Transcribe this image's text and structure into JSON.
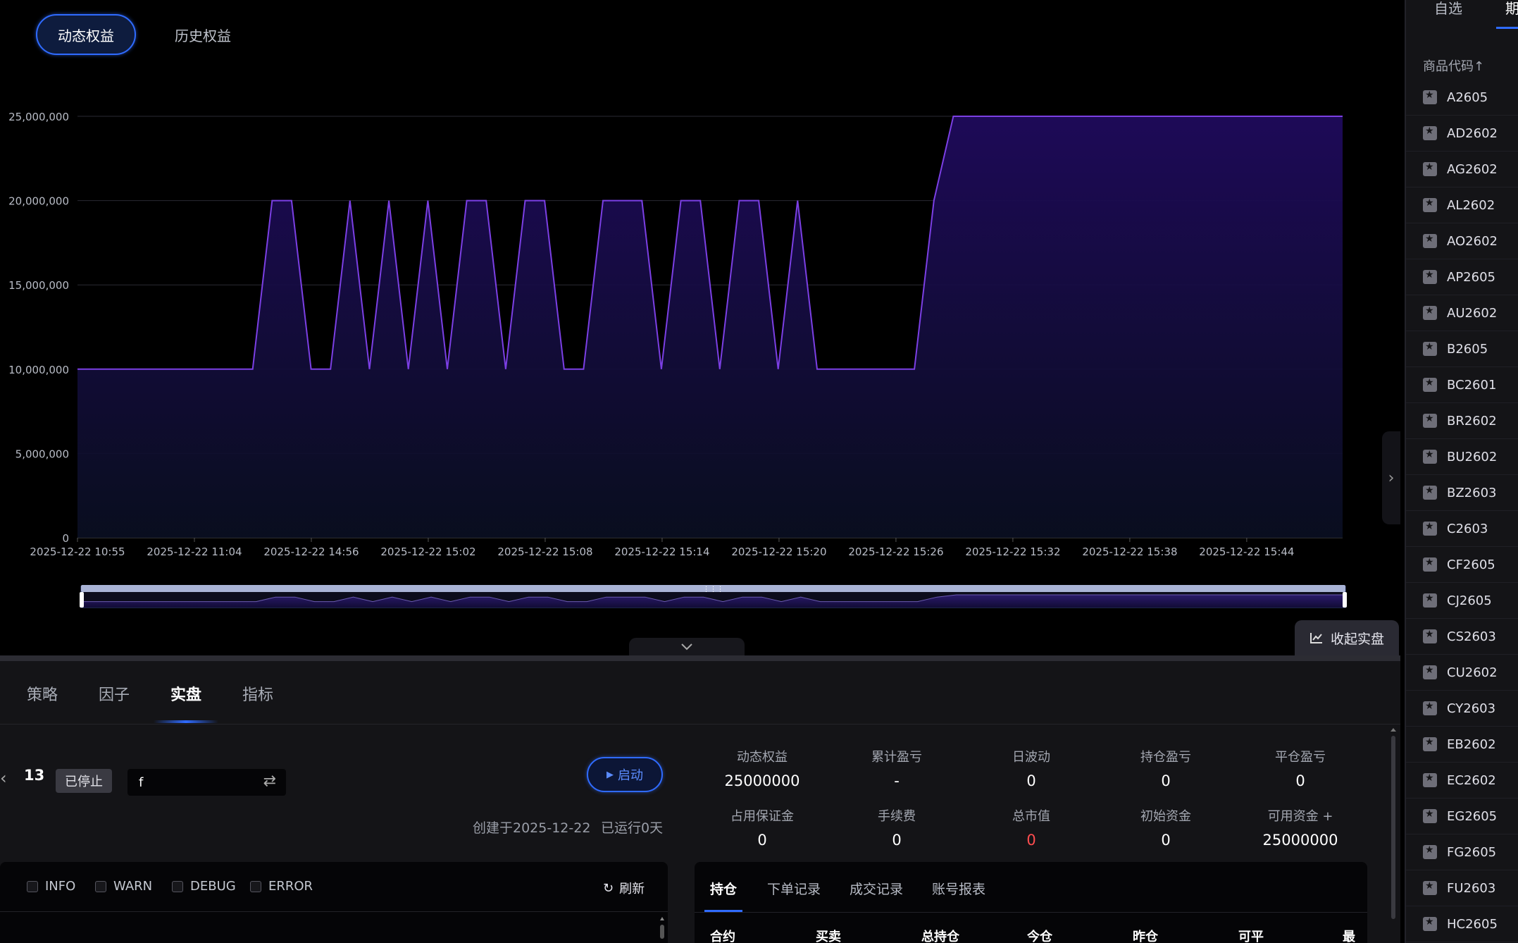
{
  "top_tabs": {
    "dynamic": "动态权益",
    "history": "历史权益"
  },
  "collapse_button": "收起实盘",
  "chart_data": {
    "type": "area",
    "x": [
      "2025-12-22 10:55",
      "2025-12-22 11:04",
      "2025-12-22 14:56",
      "2025-12-22 15:02",
      "2025-12-22 15:08",
      "2025-12-22 15:14",
      "2025-12-22 15:20",
      "2025-12-22 15:26",
      "2025-12-22 15:32",
      "2025-12-22 15:38",
      "2025-12-22 15:44"
    ],
    "yticks": [
      "0",
      "5,000,000",
      "10,000,000",
      "15,000,000",
      "20,000,000",
      "25,000,000"
    ],
    "ylim": [
      0,
      25000000
    ],
    "values": [
      10000000,
      10000000,
      10000000,
      10000000,
      10000000,
      10000000,
      10000000,
      10000000,
      10000000,
      10000000,
      20000000,
      20000000,
      10000000,
      10000000,
      20000000,
      10000000,
      20000000,
      10000000,
      20000000,
      10000000,
      20000000,
      20000000,
      10000000,
      20000000,
      20000000,
      10000000,
      10000000,
      20000000,
      20000000,
      20000000,
      10000000,
      20000000,
      20000000,
      10000000,
      20000000,
      20000000,
      10000000,
      20000000,
      10000000,
      10000000,
      10000000,
      10000000,
      10000000,
      10000000,
      20000000,
      25000000,
      25000000,
      25000000,
      25000000,
      25000000,
      25000000,
      25000000,
      25000000,
      25000000,
      25000000,
      25000000,
      25000000,
      25000000,
      25000000,
      25000000,
      25000000,
      25000000,
      25000000,
      25000000,
      25000000,
      25000000
    ],
    "line_color": "#7b3fe4",
    "grid": true
  },
  "bottom_tabs": [
    "策略",
    "因子",
    "实盘",
    "指标"
  ],
  "strategy": {
    "id": "13",
    "status": "已停止",
    "input_value": "f",
    "start_label": "启动",
    "created": "创建于2025-12-22",
    "running": "已运行0天"
  },
  "stats": [
    {
      "label": "动态权益",
      "value": "25000000"
    },
    {
      "label": "累计盈亏",
      "value": "-"
    },
    {
      "label": "日波动",
      "value": "0"
    },
    {
      "label": "持仓盈亏",
      "value": "0"
    },
    {
      "label": "平仓盈亏",
      "value": "0"
    },
    {
      "label": "占用保证金",
      "value": "0"
    },
    {
      "label": "手续费",
      "value": "0"
    },
    {
      "label": "总市值",
      "value": "0"
    },
    {
      "label": "初始资金",
      "value": "0"
    },
    {
      "label": "可用资金 +",
      "value": "25000000"
    }
  ],
  "log": {
    "filters": [
      "INFO",
      "WARN",
      "DEBUG",
      "ERROR"
    ],
    "refresh": "刷新"
  },
  "positions": {
    "tabs": [
      "持仓",
      "下单记录",
      "成交记录",
      "账号报表"
    ],
    "columns": [
      "合约",
      "买卖",
      "总持仓",
      "今仓",
      "昨仓",
      "可平",
      "最"
    ]
  },
  "sidebar": {
    "tabs": [
      "自选",
      "期"
    ],
    "column_title": "商品代码↑",
    "symbols": [
      "A2605",
      "AD2602",
      "AG2602",
      "AL2602",
      "AO2602",
      "AP2605",
      "AU2602",
      "B2605",
      "BC2601",
      "BR2602",
      "BU2602",
      "BZ2603",
      "C2603",
      "CF2605",
      "CJ2605",
      "CS2603",
      "CU2602",
      "CY2603",
      "EB2602",
      "EC2602",
      "EG2605",
      "FG2605",
      "FU2603",
      "HC2605"
    ]
  },
  "colors": {
    "accent": "#2f6bff",
    "negative": "#ff4d4f",
    "series": "#7b3fe4"
  }
}
